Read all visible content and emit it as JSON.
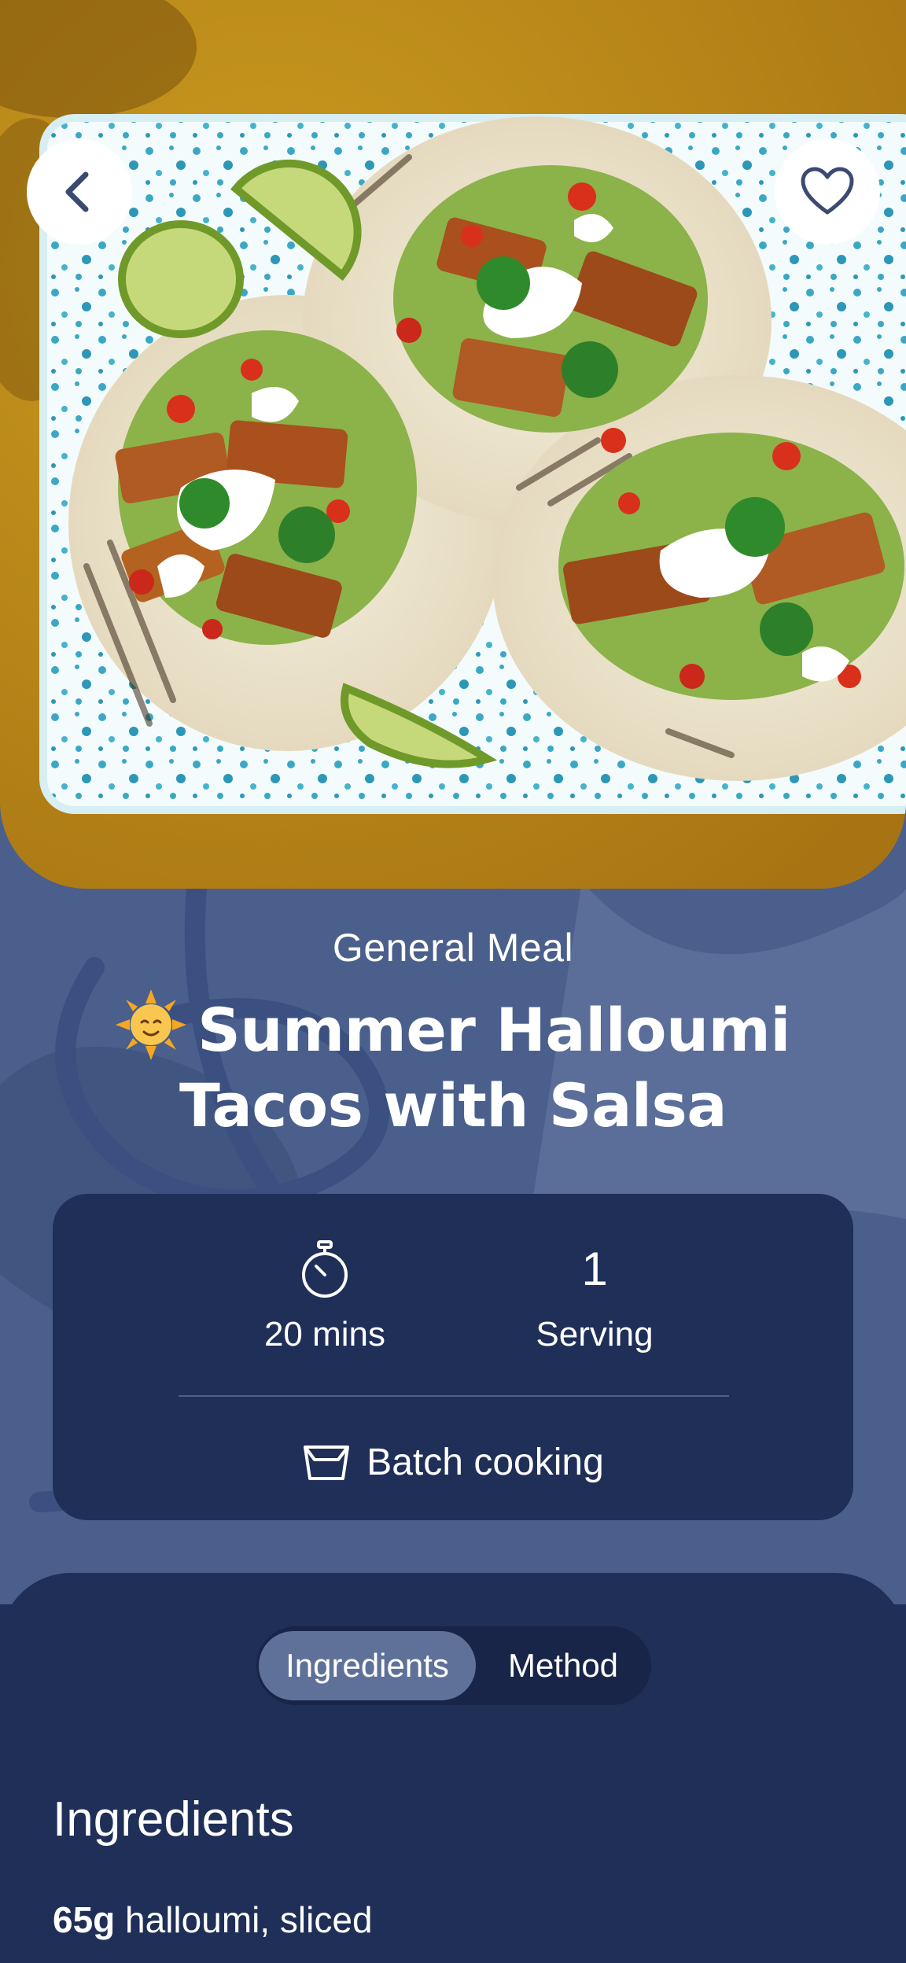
{
  "hero": {
    "image_alt": "Halloumi tacos with salsa on a speckled tray",
    "back_icon": "chevron-left-icon",
    "favorite_icon": "heart-outline-icon"
  },
  "recipe": {
    "category": "General Meal",
    "title_emoji": "sun-with-face",
    "title": "Summer Halloumi Tacos with Salsa"
  },
  "stats": {
    "time_icon": "stopwatch-icon",
    "time": "20 mins",
    "servings_number": "1",
    "servings_label": "Serving",
    "batch_icon": "container-icon",
    "batch_label": "Batch cooking"
  },
  "tabs": [
    {
      "label": "Ingredients",
      "active": true
    },
    {
      "label": "Method",
      "active": false
    }
  ],
  "ingredients": {
    "heading": "Ingredients",
    "items": [
      {
        "quantity": "65g",
        "name": "halloumi, sliced"
      }
    ]
  },
  "colors": {
    "page_background": "#1f2f58",
    "header_background": "#4a5f8c",
    "active_tab": "#5f7199",
    "button_background": "#ffffff",
    "icon_color": "#3b4a70"
  }
}
